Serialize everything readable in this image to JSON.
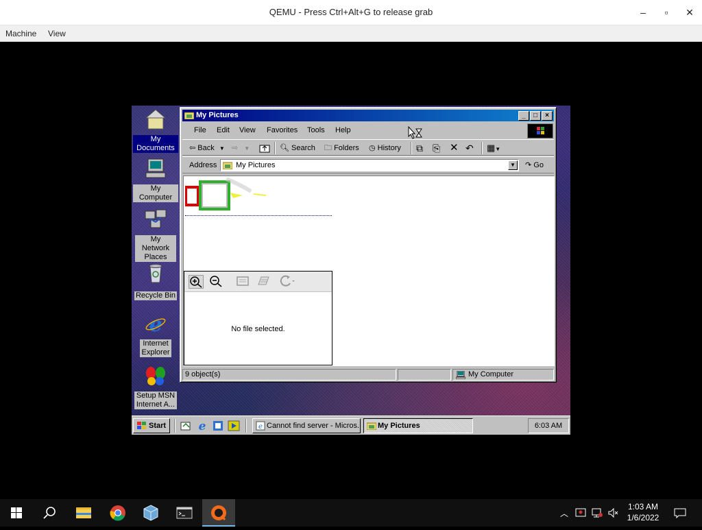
{
  "host": {
    "window_title": "QEMU - Press Ctrl+Alt+G to release grab",
    "menus": [
      "Machine",
      "View"
    ],
    "controls": {
      "minimize": "–",
      "maximize": "▫",
      "close": "✕"
    },
    "clock_time": "1:03 AM",
    "clock_date": "1/6/2022"
  },
  "guest": {
    "desktop_icons": [
      {
        "label": "My Documents",
        "selected": true
      },
      {
        "label": "My Computer"
      },
      {
        "label": "My Network Places"
      },
      {
        "label": "Recycle Bin"
      },
      {
        "label": "Internet Explorer"
      },
      {
        "label": "Setup MSN Internet A..."
      }
    ],
    "explorer": {
      "title": "My Pictures",
      "menus": [
        "File",
        "Edit",
        "View",
        "Favorites",
        "Tools",
        "Help"
      ],
      "toolbar": {
        "back": "Back",
        "search": "Search",
        "folders": "Folders",
        "history": "History"
      },
      "address_label": "Address",
      "address_value": "My Pictures",
      "go_label": "Go",
      "preview_message": "No file selected.",
      "status_objects": "9 object(s)",
      "status_zone": "My Computer"
    },
    "taskbar": {
      "start_label": "Start",
      "tasks": [
        {
          "label": "Cannot find server - Micros...",
          "active": false
        },
        {
          "label": "My Pictures",
          "active": true
        }
      ],
      "clock": "6:03 AM"
    }
  },
  "colors": {
    "title_active": "#000080",
    "win98_face": "#c0c0c0",
    "host_taskbar": "#101010"
  }
}
